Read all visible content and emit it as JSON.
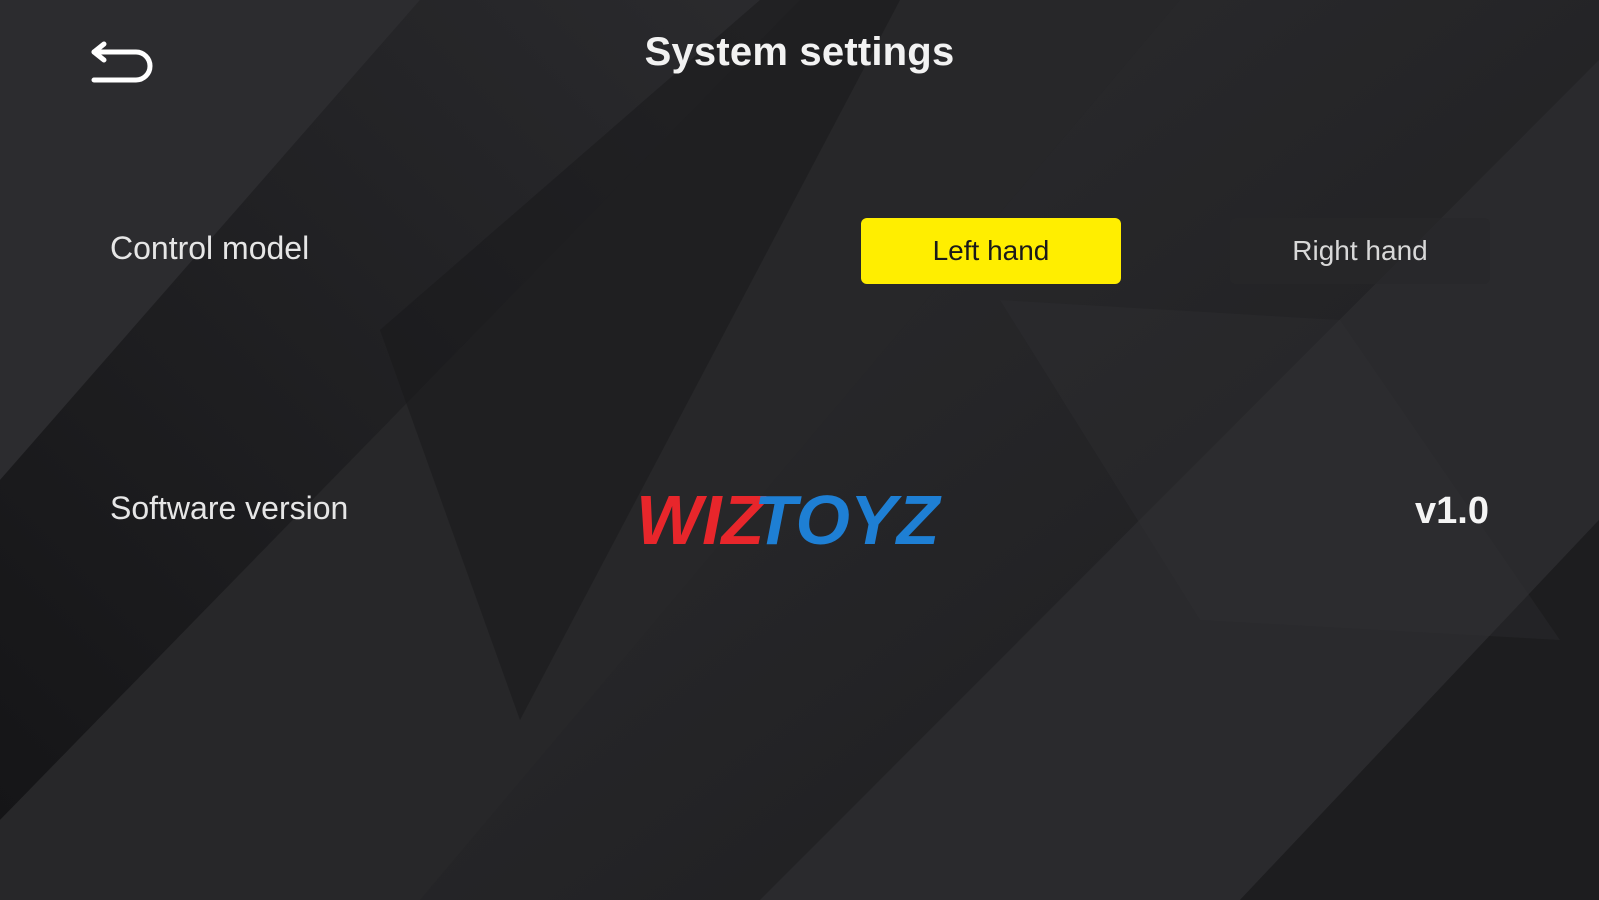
{
  "header": {
    "title": "System settings",
    "back_icon": "back-arrow-icon"
  },
  "control_model": {
    "label": "Control model",
    "options": [
      "Left hand",
      "Right hand"
    ],
    "selected": "Left hand",
    "accent_color": "#ffee00"
  },
  "software": {
    "label": "Software version",
    "logo_text_red": "WIZ",
    "logo_text_blue": "TOYZ",
    "logo_red_color": "#e8262b",
    "logo_blue_color": "#1e7fd4",
    "version": "v1.0"
  }
}
